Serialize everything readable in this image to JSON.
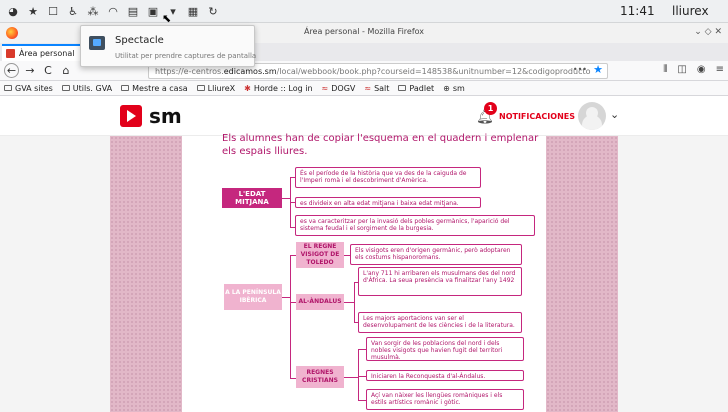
{
  "os_panel": {
    "clock": "11:41",
    "user": "lliurex",
    "icons": [
      "app-icon",
      "star-icon",
      "window-icon",
      "accessibility-icon",
      "network-icon",
      "wifi-icon",
      "clipboard-icon",
      "screen-icon",
      "dropdown-icon",
      "spectacle-icon",
      "refresh-icon"
    ]
  },
  "firefox": {
    "window_title": "Área personal - Mozilla Firefox",
    "tab_label": "Àrea personal",
    "url_prefix": "https://e-centros.",
    "url_domain": "edicamos.sm",
    "url_path": "/local/webbook/book.php?courseid=148538&unitnumber=12&codigoproducto",
    "url_dots": "•••",
    "bookmarks": [
      "GVA sites",
      "Utils. GVA",
      "Mestre a casa",
      "LliureX",
      "Horde :: Log in",
      "DOGV",
      "Salt",
      "Padlet",
      "sm"
    ]
  },
  "spectacle": {
    "title": "Spectacle",
    "description": "Utilitat per prendre captures de pantalla"
  },
  "sm_site": {
    "logo": "sm",
    "notifications_label": "NOTIFICACIONES",
    "notifications_count": "1"
  },
  "book": {
    "intro": "Els alumnes han de copiar l'esquema en el quadern i emplenar els espais lliures.",
    "edat_mitjana": {
      "label": "L'EDAT MITJANA",
      "boxes": [
        "És el període de la història que va des de la caiguda de l'Imperi romà i el descobriment d'Amèrica.",
        "es divideix en alta edat mitjana i baixa edat mitjana.",
        "es va caracteritzar per la invasió dels pobles germànics, l'aparició del sistema feudal i el sorgiment de la burgesia."
      ]
    },
    "peninsula": {
      "label": "A LA PENÍNSULA IBÈRICA",
      "regne_visigot": {
        "label": "EL REGNE VISIGOT DE TOLEDO",
        "box": "Els visigots eren d'origen germànic, però adoptaren els costums hispanoromans."
      },
      "al_andalus": {
        "label": "AL-ÀNDALUS",
        "boxes": [
          "L'any 711 hi arribaren els musulmans des del nord d'Àfrica. La seua presència va finalitzar l'any 1492",
          "Les majors aportacions van ser el desenvolupament de les ciències i de la literatura."
        ]
      },
      "regnes_cristians": {
        "label": "REGNES CRISTIANS",
        "boxes": [
          "Van sorgir de les poblacions del nord i dels nobles visigots que havien fugit del territori musulmà.",
          "Iniciaren la Reconquesta d'al-Àndalus.",
          "Açí van nàixer les llengües romàniques i els estils artístics romànic i gòtic."
        ]
      }
    }
  },
  "colors": {
    "brand_red": "#e2001a",
    "scheme_magenta": "#c5277e",
    "scheme_pink": "#f0b3cf"
  }
}
